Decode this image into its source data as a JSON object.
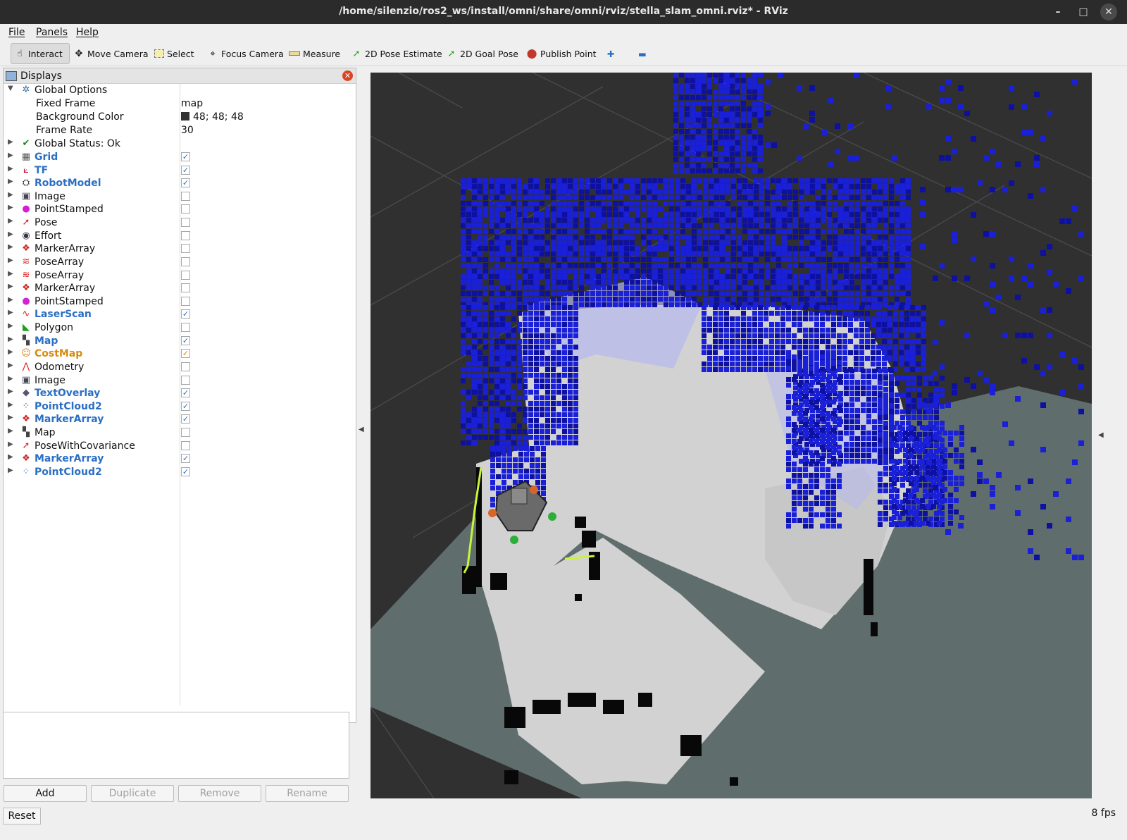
{
  "window": {
    "title": "/home/silenzio/ros2_ws/install/omni/share/omni/rviz/stella_slam_omni.rviz* - RViz",
    "min_glyph": "–",
    "max_glyph": "□",
    "close_glyph": "✕"
  },
  "menu": {
    "file": "File",
    "panels": "Panels",
    "help": "Help"
  },
  "toolbar": {
    "interact": "Interact",
    "move_camera": "Move Camera",
    "select": "Select",
    "focus_camera": "Focus Camera",
    "measure": "Measure",
    "pose_estimate": "2D Pose Estimate",
    "goal_pose": "2D Goal Pose",
    "publish_point": "Publish Point",
    "add_glyph": "✚",
    "remove_glyph": "▬"
  },
  "displays": {
    "title": "Displays",
    "global_options": {
      "label": "Global Options",
      "fixed_frame_label": "Fixed Frame",
      "fixed_frame_value": "map",
      "background_color_label": "Background Color",
      "background_color_value": "48; 48; 48",
      "frame_rate_label": "Frame Rate",
      "frame_rate_value": "30"
    },
    "global_status": "Global Status: Ok",
    "items": [
      {
        "label": "Grid",
        "checked": true,
        "style": "blue",
        "icon": "▦",
        "icon_color": "#555"
      },
      {
        "label": "TF",
        "checked": true,
        "style": "blue",
        "icon": "⟀",
        "icon_color": "#c03"
      },
      {
        "label": "RobotModel",
        "checked": true,
        "style": "blue",
        "icon": "⛭",
        "icon_color": "#333"
      },
      {
        "label": "Image",
        "checked": false,
        "style": "plain",
        "icon": "▣",
        "icon_color": "#445"
      },
      {
        "label": "PointStamped",
        "checked": false,
        "style": "plain",
        "icon": "●",
        "icon_color": "#d41fd4"
      },
      {
        "label": "Pose",
        "checked": false,
        "style": "plain",
        "icon": "➚",
        "icon_color": "#d22"
      },
      {
        "label": "Effort",
        "checked": false,
        "style": "plain",
        "icon": "◉",
        "icon_color": "#334"
      },
      {
        "label": "MarkerArray",
        "checked": false,
        "style": "plain",
        "icon": "❖",
        "icon_color": "#c22"
      },
      {
        "label": "PoseArray",
        "checked": false,
        "style": "plain",
        "icon": "≋",
        "icon_color": "#d22"
      },
      {
        "label": "PoseArray",
        "checked": false,
        "style": "plain",
        "icon": "≋",
        "icon_color": "#d22"
      },
      {
        "label": "MarkerArray",
        "checked": false,
        "style": "plain",
        "icon": "❖",
        "icon_color": "#c22"
      },
      {
        "label": "PointStamped",
        "checked": false,
        "style": "plain",
        "icon": "●",
        "icon_color": "#d41fd4"
      },
      {
        "label": "LaserScan",
        "checked": true,
        "style": "blue",
        "icon": "∿",
        "icon_color": "#d22"
      },
      {
        "label": "Polygon",
        "checked": false,
        "style": "plain",
        "icon": "◣",
        "icon_color": "#1a9e1a"
      },
      {
        "label": "Map",
        "checked": true,
        "style": "blue",
        "icon": "▚",
        "icon_color": "#444"
      },
      {
        "label": "CostMap",
        "checked": true,
        "style": "orange",
        "icon": "☺",
        "icon_color": "#e07a10"
      },
      {
        "label": "Odometry",
        "checked": false,
        "style": "plain",
        "icon": "⋀",
        "icon_color": "#d22"
      },
      {
        "label": "Image",
        "checked": false,
        "style": "plain",
        "icon": "▣",
        "icon_color": "#445"
      },
      {
        "label": "TextOverlay",
        "checked": true,
        "style": "blue",
        "icon": "◆",
        "icon_color": "#557"
      },
      {
        "label": "PointCloud2",
        "checked": true,
        "style": "blue",
        "icon": "⁘",
        "icon_color": "#2b6fc4"
      },
      {
        "label": "MarkerArray",
        "checked": true,
        "style": "blue",
        "icon": "❖",
        "icon_color": "#c22"
      },
      {
        "label": "Map",
        "checked": false,
        "style": "plain",
        "icon": "▚",
        "icon_color": "#444"
      },
      {
        "label": "PoseWithCovariance",
        "checked": false,
        "style": "plain",
        "icon": "➚",
        "icon_color": "#d22"
      },
      {
        "label": "MarkerArray",
        "checked": true,
        "style": "blue",
        "icon": "❖",
        "icon_color": "#c22"
      },
      {
        "label": "PointCloud2",
        "checked": true,
        "style": "blue",
        "icon": "⁘",
        "icon_color": "#2b6fc4"
      }
    ]
  },
  "buttons": {
    "add": "Add",
    "duplicate": "Duplicate",
    "remove": "Remove",
    "rename": "Rename",
    "reset": "Reset"
  },
  "status": {
    "fps": "8 fps"
  },
  "colors": {
    "background": "#303030",
    "floor": "#5f6e6c",
    "free": "#d2d2d2",
    "occupied": "#080808",
    "voxel": "#1a1fd8",
    "voxel_dark": "#0d10a0",
    "shadow": "#b6b8ee",
    "grid": "#4a4a4a"
  }
}
